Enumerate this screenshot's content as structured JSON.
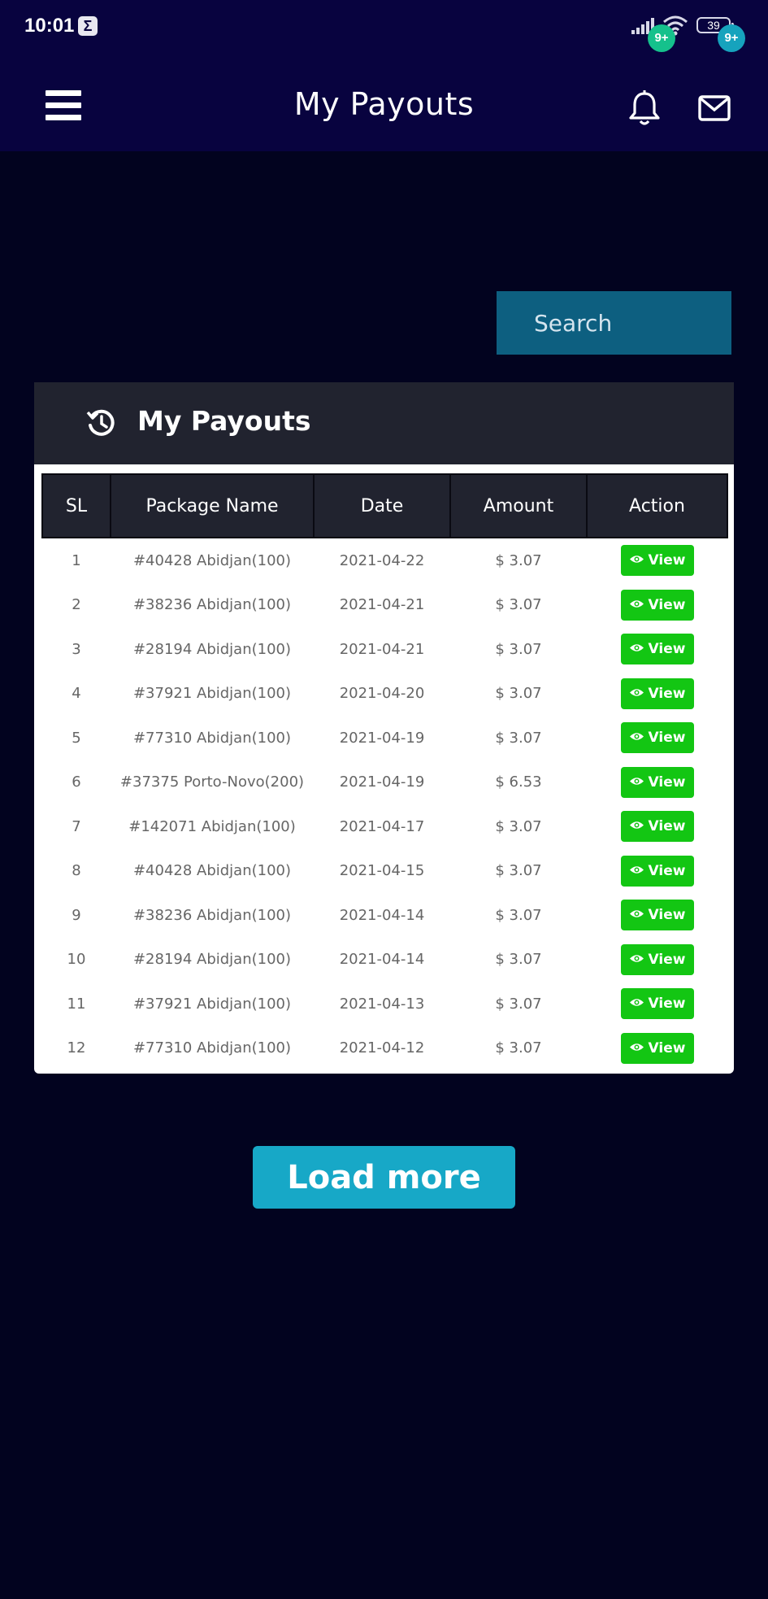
{
  "status_bar": {
    "time": "10:01",
    "app_icon": "Σ",
    "battery": "39"
  },
  "header": {
    "title": "My Payouts",
    "notification_badge": "9+",
    "mail_badge": "9+"
  },
  "search": {
    "placeholder": "Search"
  },
  "card": {
    "title": "My Payouts",
    "columns": [
      "SL",
      "Package Name",
      "Date",
      "Amount",
      "Action"
    ],
    "rows": [
      {
        "sl": "1",
        "package": "#40428 Abidjan(100)",
        "date": "2021-04-22",
        "amount": "$ 3.07",
        "action": "View"
      },
      {
        "sl": "2",
        "package": "#38236 Abidjan(100)",
        "date": "2021-04-21",
        "amount": "$ 3.07",
        "action": "View"
      },
      {
        "sl": "3",
        "package": "#28194 Abidjan(100)",
        "date": "2021-04-21",
        "amount": "$ 3.07",
        "action": "View"
      },
      {
        "sl": "4",
        "package": "#37921 Abidjan(100)",
        "date": "2021-04-20",
        "amount": "$ 3.07",
        "action": "View"
      },
      {
        "sl": "5",
        "package": "#77310 Abidjan(100)",
        "date": "2021-04-19",
        "amount": "$ 3.07",
        "action": "View"
      },
      {
        "sl": "6",
        "package": "#37375 Porto-Novo(200)",
        "date": "2021-04-19",
        "amount": "$ 6.53",
        "action": "View"
      },
      {
        "sl": "7",
        "package": "#142071 Abidjan(100)",
        "date": "2021-04-17",
        "amount": "$ 3.07",
        "action": "View"
      },
      {
        "sl": "8",
        "package": "#40428 Abidjan(100)",
        "date": "2021-04-15",
        "amount": "$ 3.07",
        "action": "View"
      },
      {
        "sl": "9",
        "package": "#38236 Abidjan(100)",
        "date": "2021-04-14",
        "amount": "$ 3.07",
        "action": "View"
      },
      {
        "sl": "10",
        "package": "#28194 Abidjan(100)",
        "date": "2021-04-14",
        "amount": "$ 3.07",
        "action": "View"
      },
      {
        "sl": "11",
        "package": "#37921 Abidjan(100)",
        "date": "2021-04-13",
        "amount": "$ 3.07",
        "action": "View"
      },
      {
        "sl": "12",
        "package": "#77310 Abidjan(100)",
        "date": "2021-04-12",
        "amount": "$ 3.07",
        "action": "View"
      }
    ]
  },
  "load_more_label": "Load more",
  "icons": {
    "menu": "hamburger-menu-icon",
    "notifications": "bell-icon",
    "messages": "envelope-icon",
    "history": "history-icon",
    "view": "eye-icon"
  },
  "colors": {
    "header_bg": "#08033f",
    "page_bg": "#02031f",
    "search_bg": "#0d5f80",
    "card_header_bg": "#21232f",
    "view_button": "#13c613",
    "load_more": "#17a8c7",
    "notification_badge": "#15c18c",
    "mail_badge": "#16a3bd"
  }
}
